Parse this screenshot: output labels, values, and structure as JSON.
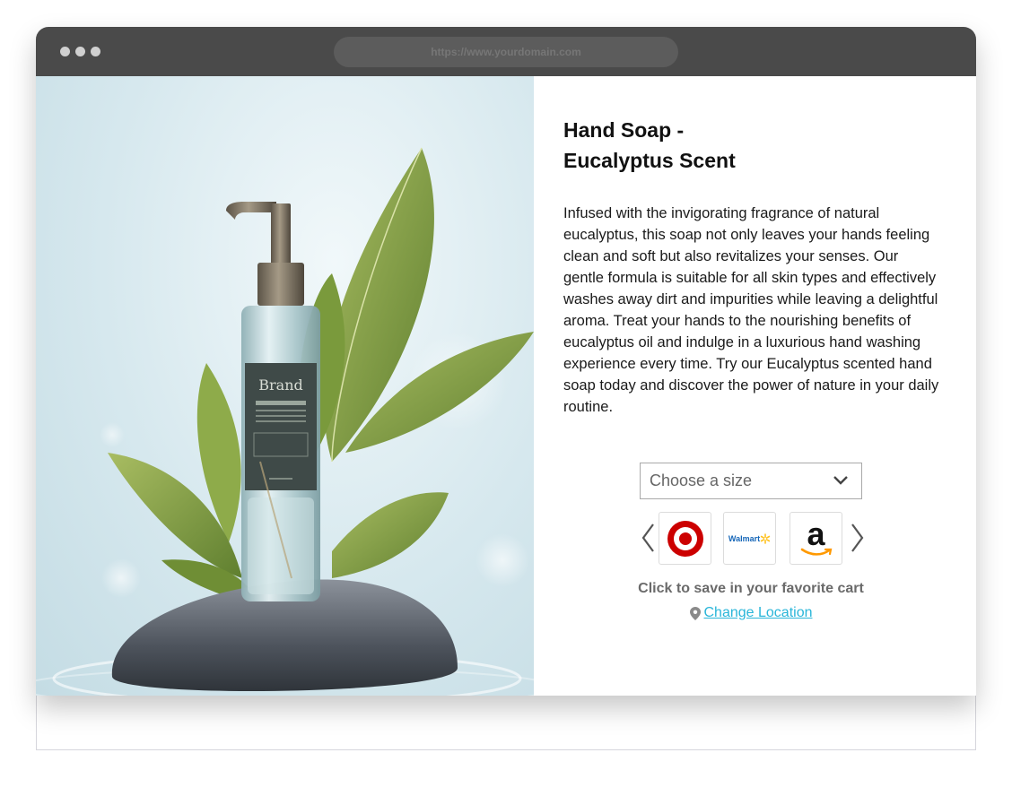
{
  "browser": {
    "url": "https://www.yourdomain.com"
  },
  "hero": {
    "brand_label": "Brand"
  },
  "product": {
    "title_line1": "Hand Soap -",
    "title_line2": "Eucalyptus Scent",
    "description": "Infused with the invigorating fragrance of natural eucalyptus, this soap not only leaves your hands feeling clean and soft but also revitalizes your senses. Our gentle formula is suitable for all skin types and effectively washes away dirt and impurities while leaving a delightful aroma. Treat your hands to the nourishing benefits of eucalyptus oil and indulge in a luxurious hand washing experience every time. Try our Eucalyptus scented hand soap today and discover the power of nature in your daily routine."
  },
  "size_select": {
    "placeholder": "Choose a size",
    "icon": "chevron-down-icon"
  },
  "stores": [
    {
      "name": "Target",
      "icon": "target-logo"
    },
    {
      "name": "Walmart",
      "label": "Walmart",
      "icon": "walmart-logo"
    },
    {
      "name": "Amazon",
      "label": "a",
      "icon": "amazon-logo"
    }
  ],
  "cart": {
    "save_text": "Click to save in your favorite cart",
    "change_location": "Change Location"
  },
  "colors": {
    "titlebar": "#4a4a4a",
    "link": "#2ab6d9",
    "target_red": "#cc0000",
    "walmart_blue": "#1566b8",
    "walmart_yellow": "#ffc220",
    "amazon_orange": "#ff9900"
  }
}
